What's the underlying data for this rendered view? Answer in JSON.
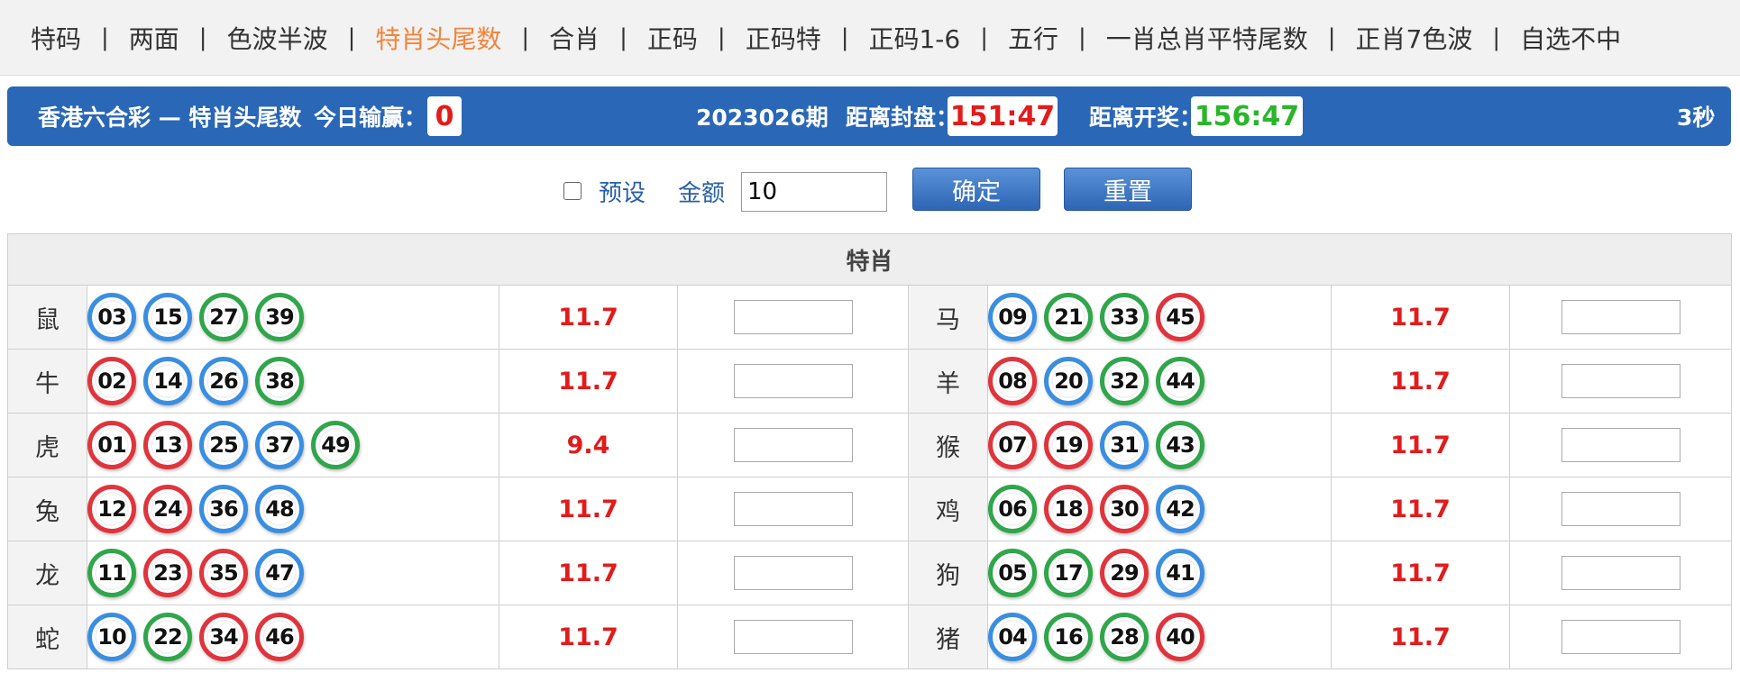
{
  "nav": {
    "items": [
      {
        "label": "特码",
        "active": false
      },
      {
        "label": "两面",
        "active": false
      },
      {
        "label": "色波半波",
        "active": false
      },
      {
        "label": "特肖头尾数",
        "active": true
      },
      {
        "label": "合肖",
        "active": false
      },
      {
        "label": "正码",
        "active": false
      },
      {
        "label": "正码特",
        "active": false
      },
      {
        "label": "正码1-6",
        "active": false
      },
      {
        "label": "五行",
        "active": false
      },
      {
        "label": "一肖总肖平特尾数",
        "active": false
      },
      {
        "label": "正肖7色波",
        "active": false
      },
      {
        "label": "自选不中",
        "active": false
      }
    ],
    "separator": "|"
  },
  "header": {
    "title": "香港六合彩 — 特肖头尾数",
    "today_label": "今日输赢：",
    "today_value": "0",
    "period": "2023026期",
    "close_label": "距离封盘：",
    "close_time": "151:47",
    "draw_label": "距离开奖：",
    "draw_time": "156:47",
    "refresh": "3秒"
  },
  "controls": {
    "preset_label": "预设",
    "amount_label": "金额",
    "amount_value": "10",
    "confirm_label": "确定",
    "reset_label": "重置"
  },
  "table": {
    "heading": "特肖",
    "rows": [
      {
        "left": {
          "zodiac": "鼠",
          "balls": [
            {
              "n": "03",
              "c": "blue"
            },
            {
              "n": "15",
              "c": "blue"
            },
            {
              "n": "27",
              "c": "green"
            },
            {
              "n": "39",
              "c": "green"
            }
          ],
          "odds": "11.7"
        },
        "right": {
          "zodiac": "马",
          "balls": [
            {
              "n": "09",
              "c": "blue"
            },
            {
              "n": "21",
              "c": "green"
            },
            {
              "n": "33",
              "c": "green"
            },
            {
              "n": "45",
              "c": "red"
            }
          ],
          "odds": "11.7"
        }
      },
      {
        "left": {
          "zodiac": "牛",
          "balls": [
            {
              "n": "02",
              "c": "red"
            },
            {
              "n": "14",
              "c": "blue"
            },
            {
              "n": "26",
              "c": "blue"
            },
            {
              "n": "38",
              "c": "green"
            }
          ],
          "odds": "11.7"
        },
        "right": {
          "zodiac": "羊",
          "balls": [
            {
              "n": "08",
              "c": "red"
            },
            {
              "n": "20",
              "c": "blue"
            },
            {
              "n": "32",
              "c": "green"
            },
            {
              "n": "44",
              "c": "green"
            }
          ],
          "odds": "11.7"
        }
      },
      {
        "left": {
          "zodiac": "虎",
          "balls": [
            {
              "n": "01",
              "c": "red"
            },
            {
              "n": "13",
              "c": "red"
            },
            {
              "n": "25",
              "c": "blue"
            },
            {
              "n": "37",
              "c": "blue"
            },
            {
              "n": "49",
              "c": "green"
            }
          ],
          "odds": "9.4"
        },
        "right": {
          "zodiac": "猴",
          "balls": [
            {
              "n": "07",
              "c": "red"
            },
            {
              "n": "19",
              "c": "red"
            },
            {
              "n": "31",
              "c": "blue"
            },
            {
              "n": "43",
              "c": "green"
            }
          ],
          "odds": "11.7"
        }
      },
      {
        "left": {
          "zodiac": "兔",
          "balls": [
            {
              "n": "12",
              "c": "red"
            },
            {
              "n": "24",
              "c": "red"
            },
            {
              "n": "36",
              "c": "blue"
            },
            {
              "n": "48",
              "c": "blue"
            }
          ],
          "odds": "11.7"
        },
        "right": {
          "zodiac": "鸡",
          "balls": [
            {
              "n": "06",
              "c": "green"
            },
            {
              "n": "18",
              "c": "red"
            },
            {
              "n": "30",
              "c": "red"
            },
            {
              "n": "42",
              "c": "blue"
            }
          ],
          "odds": "11.7"
        }
      },
      {
        "left": {
          "zodiac": "龙",
          "balls": [
            {
              "n": "11",
              "c": "green"
            },
            {
              "n": "23",
              "c": "red"
            },
            {
              "n": "35",
              "c": "red"
            },
            {
              "n": "47",
              "c": "blue"
            }
          ],
          "odds": "11.7"
        },
        "right": {
          "zodiac": "狗",
          "balls": [
            {
              "n": "05",
              "c": "green"
            },
            {
              "n": "17",
              "c": "green"
            },
            {
              "n": "29",
              "c": "red"
            },
            {
              "n": "41",
              "c": "blue"
            }
          ],
          "odds": "11.7"
        }
      },
      {
        "left": {
          "zodiac": "蛇",
          "balls": [
            {
              "n": "10",
              "c": "blue"
            },
            {
              "n": "22",
              "c": "green"
            },
            {
              "n": "34",
              "c": "red"
            },
            {
              "n": "46",
              "c": "red"
            }
          ],
          "odds": "11.7"
        },
        "right": {
          "zodiac": "猪",
          "balls": [
            {
              "n": "04",
              "c": "blue"
            },
            {
              "n": "16",
              "c": "green"
            },
            {
              "n": "28",
              "c": "green"
            },
            {
              "n": "40",
              "c": "red"
            }
          ],
          "odds": "11.7"
        }
      }
    ]
  },
  "colors": {
    "header_bg": "#2a67b7",
    "active_tab": "#f0843c",
    "odds": "#e21b1b",
    "close_time": "#e21b1b",
    "draw_time": "#2bb52b",
    "ball_red": "#e0343d",
    "ball_blue": "#3a8ee0",
    "ball_green": "#2fa64a"
  }
}
